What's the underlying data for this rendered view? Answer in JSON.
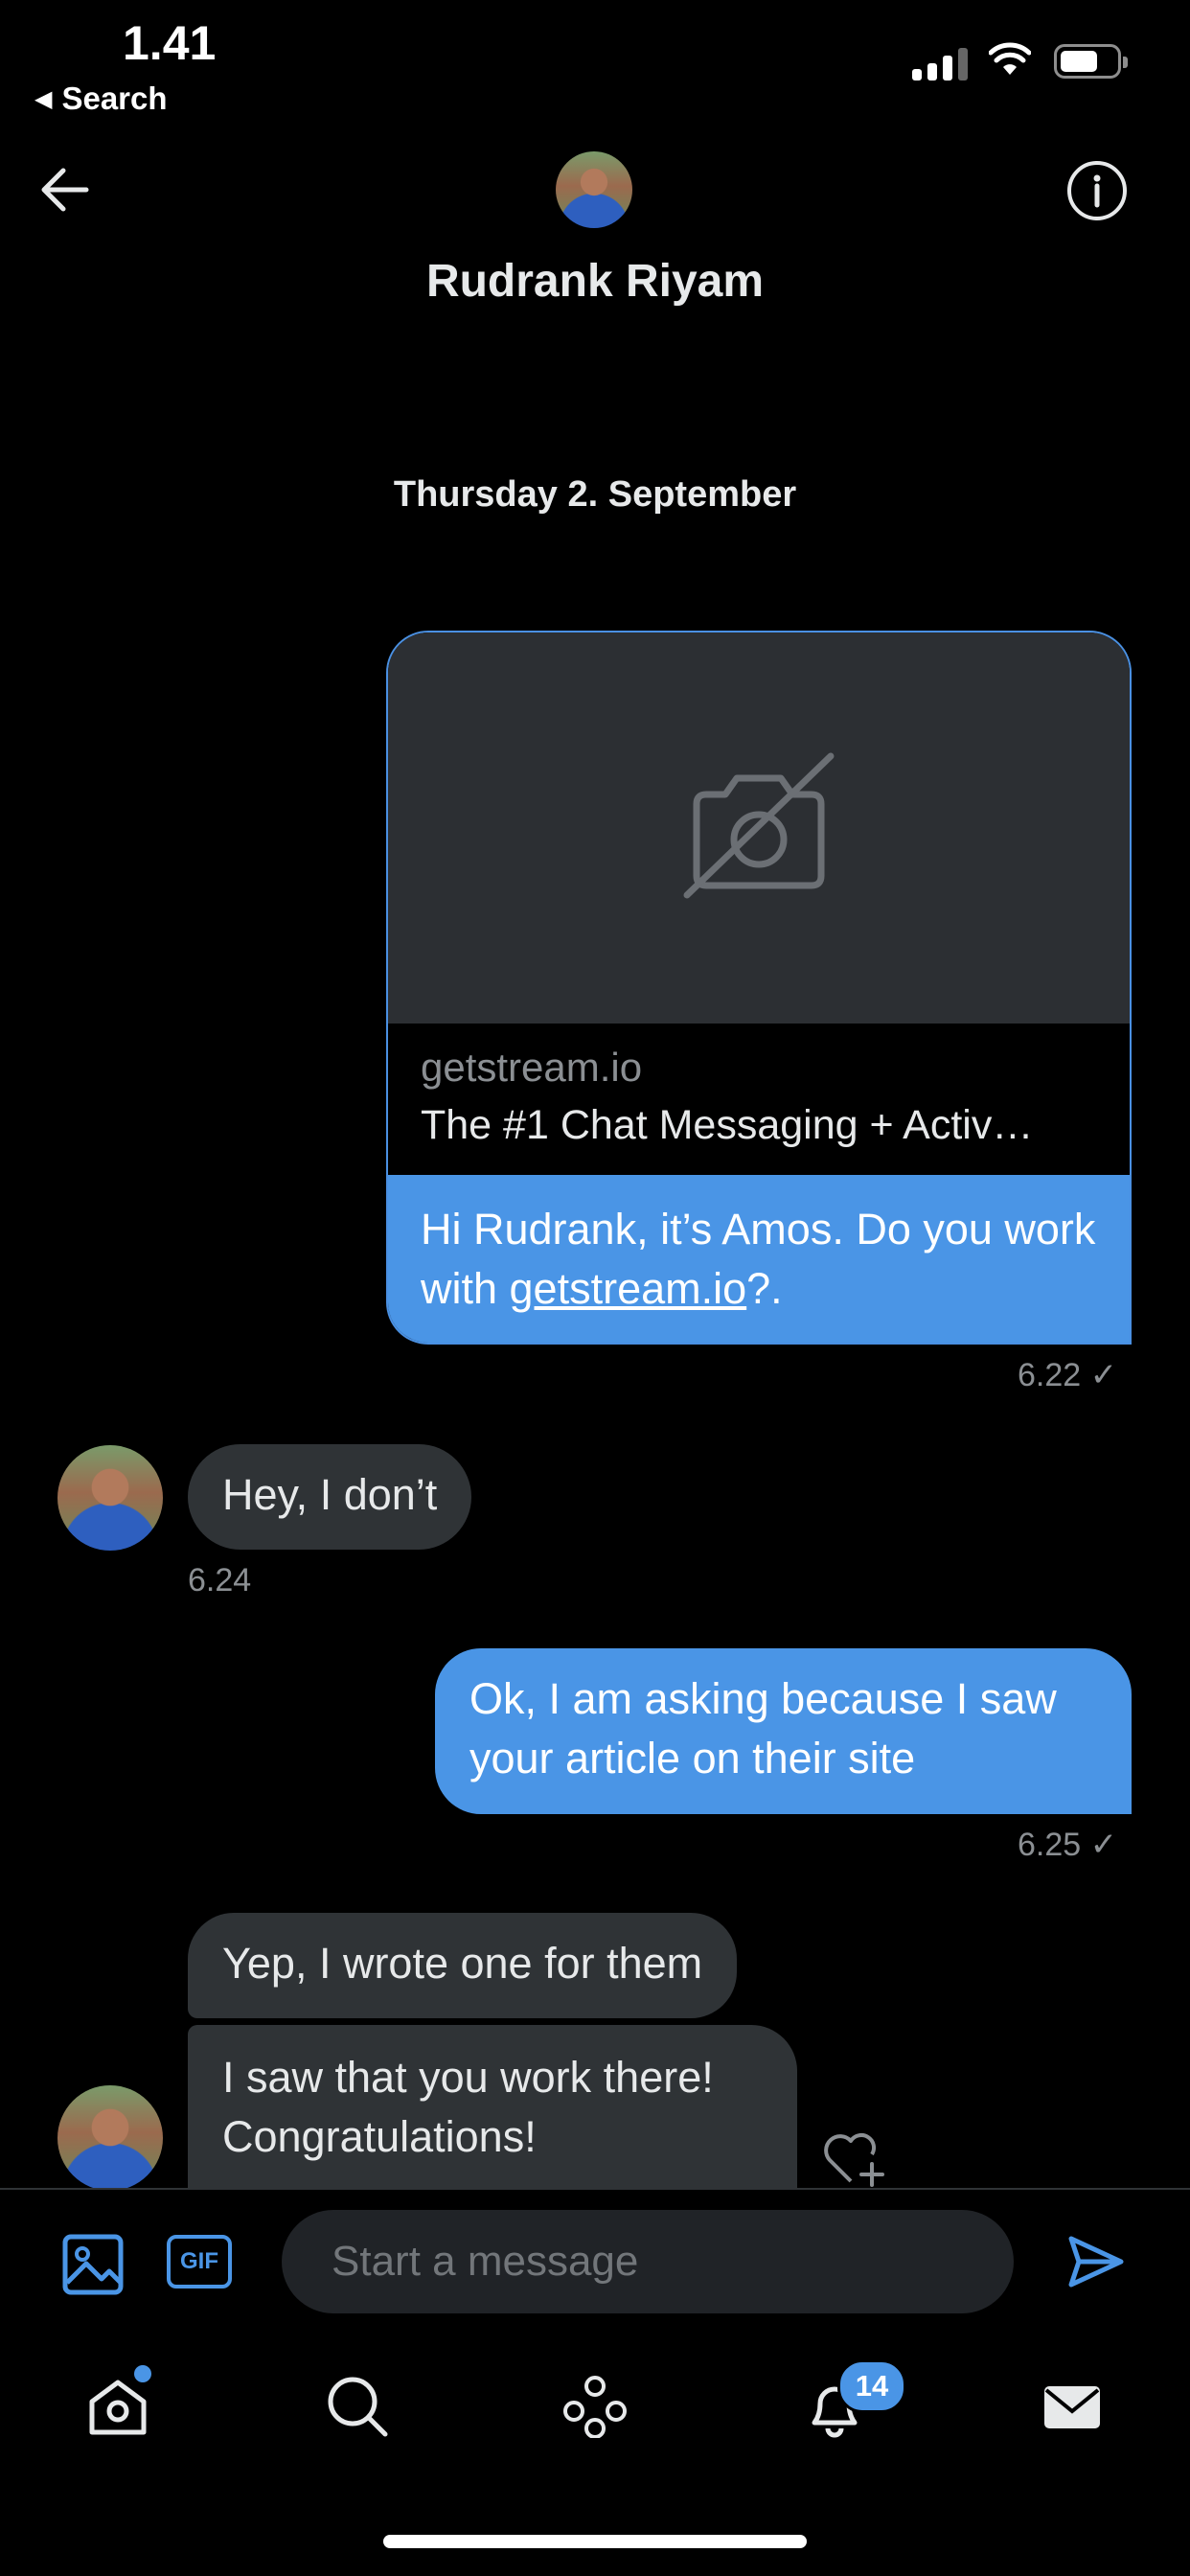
{
  "status_bar": {
    "time": "1.41",
    "back_label": "Search",
    "back_glyph": "◀"
  },
  "header": {
    "name": "Rudrank Riyam"
  },
  "conversation": {
    "date_separator": "Thursday 2. September",
    "link_card": {
      "domain": "getstream.io",
      "title": "The #1 Chat Messaging + Activ…",
      "message_prefix": "Hi Rudrank, it’s Amos. Do you work with ",
      "message_link": "getstream.io",
      "message_suffix": "?.",
      "time": "6.22 ✓"
    },
    "messages": [
      {
        "from": "them",
        "text": "Hey, I don’t",
        "time": "6.24"
      },
      {
        "from": "me",
        "text": "Ok, I am asking because I saw your article on their site",
        "time": "6.25 ✓"
      },
      {
        "from": "them",
        "text": "Yep, I wrote one for them"
      },
      {
        "from": "them",
        "text": "I saw that you work there! Congratulations!"
      }
    ]
  },
  "composer": {
    "placeholder": "Start a message",
    "gif_label": "GIF"
  },
  "tab_bar": {
    "notifications_badge": "14"
  },
  "colors": {
    "accent": "#4a95e6",
    "background": "#000000",
    "incoming_bubble": "#2f3336",
    "muted_text": "#8b8f93"
  }
}
